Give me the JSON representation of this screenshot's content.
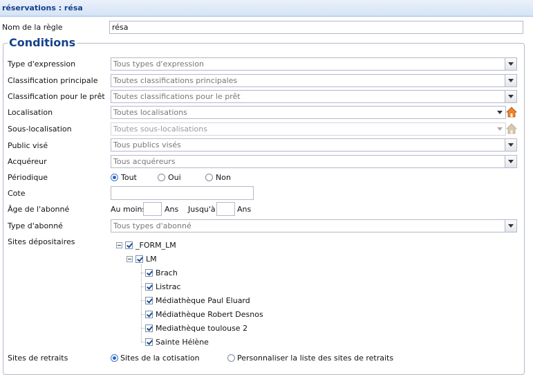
{
  "panel_title": "réservations : résa",
  "rule_name": {
    "label": "Nom de la règle",
    "value": "résa"
  },
  "conditions_title": "Conditions",
  "rows": {
    "type_expression": {
      "label": "Type d'expression",
      "value": "Tous types d'expression"
    },
    "classif_principale": {
      "label": "Classification principale",
      "value": "Toutes classifications principales"
    },
    "classif_pret": {
      "label": "Classification pour le prêt",
      "value": "Toutes classifications pour le prêt"
    },
    "localisation": {
      "label": "Localisation",
      "value": "Toutes localisations"
    },
    "sous_localisation": {
      "label": "Sous-localisation",
      "value": "Toutes sous-localisations"
    },
    "public_vise": {
      "label": "Public visé",
      "value": "Tous publics visés"
    },
    "acquereur": {
      "label": "Acquéreur",
      "value": "Tous acquéreurs"
    },
    "periodique": {
      "label": "Périodique",
      "options": [
        "Tout",
        "Oui",
        "Non"
      ],
      "selected": "Tout"
    },
    "cote": {
      "label": "Cote",
      "value": ""
    },
    "age": {
      "label": "Âge de l'abonné",
      "min_label": "Au moins",
      "unit1": "Ans",
      "max_label": "Jusqu'à",
      "unit2": "Ans",
      "min_value": "",
      "max_value": ""
    },
    "type_abonne": {
      "label": "Type d'abonné",
      "value": "Tous types d'abonné"
    },
    "sites_depositaires": {
      "label": "Sites dépositaires"
    },
    "sites_retraits": {
      "label": "Sites de retraits",
      "options": [
        "Sites de la cotisation",
        "Personnaliser la liste des sites de retraits"
      ],
      "selected": "Sites de la cotisation"
    }
  },
  "tree": {
    "root": {
      "label": "_FORM_LM",
      "checked": true
    },
    "group": {
      "label": "LM",
      "checked": true
    },
    "leaves": [
      {
        "label": "Brach",
        "checked": true
      },
      {
        "label": "Listrac",
        "checked": true
      },
      {
        "label": "Médiathèque Paul Eluard",
        "checked": true
      },
      {
        "label": "Médiathèque Robert Desnos",
        "checked": true
      },
      {
        "label": "Mediathèque toulouse 2",
        "checked": true
      },
      {
        "label": "Sainte Hélène",
        "checked": true
      }
    ]
  },
  "icons": {
    "combo_trigger": "chevron-down-icon",
    "home": "home-icon",
    "expander": "minus-icon"
  },
  "colors": {
    "accent": "#15428b",
    "border": "#b5b8c8",
    "home_active": "#e8842a",
    "home_disabled": "#c9b79f"
  }
}
